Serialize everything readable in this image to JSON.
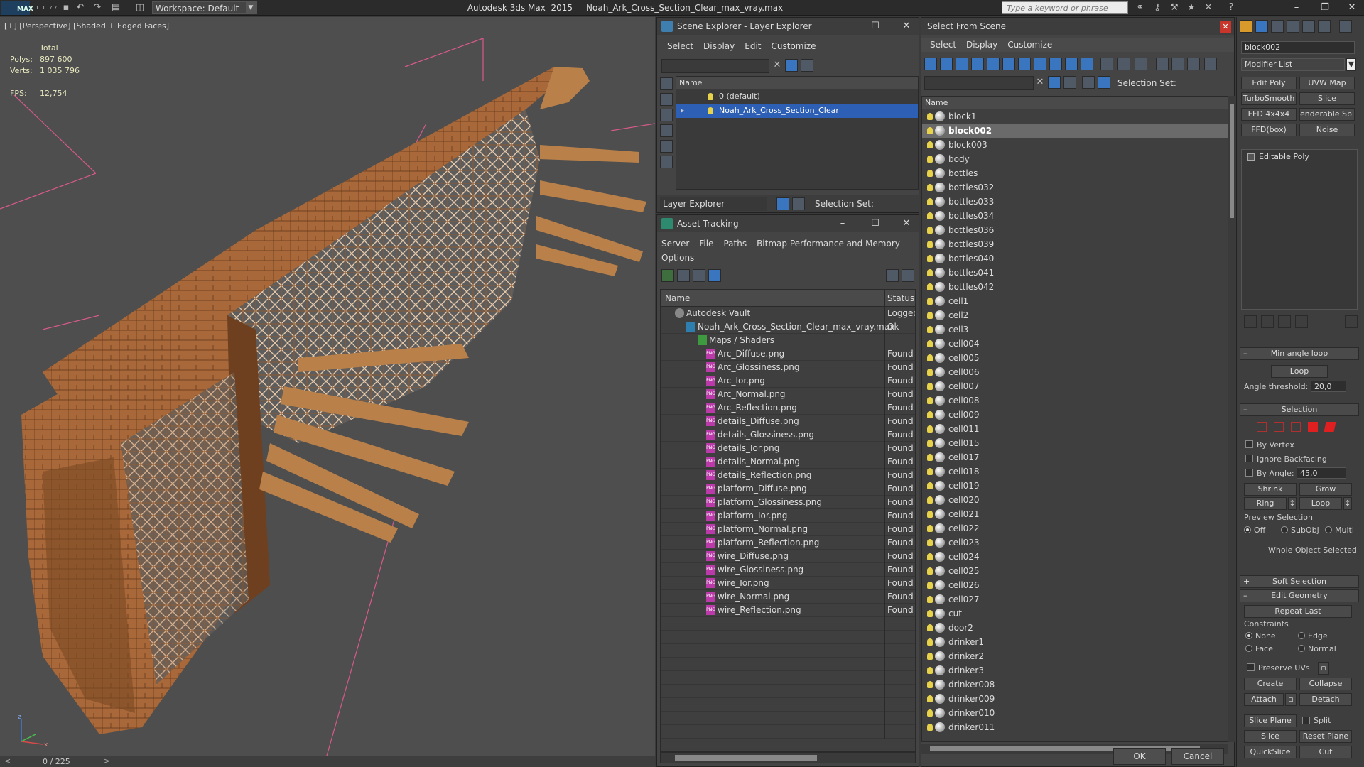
{
  "app": {
    "title": "Autodesk 3ds Max  2015     Noah_Ark_Cross_Section_Clear_max_vray.max",
    "logo": "MAX",
    "workspace": "Workspace: Default",
    "search_placeholder": "Type a keyword or phrase"
  },
  "viewport": {
    "label": "[+] [Perspective] [Shaded + Edged Faces]",
    "stats": {
      "total_label": "Total",
      "polys_label": "Polys:",
      "polys": "897 600",
      "verts_label": "Verts:",
      "verts": "1 035 796",
      "fps_label": "FPS:",
      "fps": "12,754"
    },
    "frame_counter": "0 / 225",
    "axis_x": "x",
    "axis_z": "z"
  },
  "scene_explorer": {
    "title": "Scene Explorer - Layer Explorer",
    "menu": [
      "Select",
      "Display",
      "Edit",
      "Customize"
    ],
    "column": "Name",
    "rows": [
      "0 (default)",
      "Noah_Ark_Cross_Section_Clear"
    ],
    "footer_dropdown": "Layer Explorer",
    "selection_set": "Selection Set:"
  },
  "asset_tracking": {
    "title": "Asset Tracking",
    "menu": [
      "Server",
      "File",
      "Paths",
      "Bitmap Performance and Memory"
    ],
    "menu2": [
      "Options"
    ],
    "columns": {
      "name": "Name",
      "status": "Status"
    },
    "rows": [
      {
        "name": "Autodesk Vault",
        "status": "Logged",
        "level": 0,
        "kind": "vault"
      },
      {
        "name": "Noah_Ark_Cross_Section_Clear_max_vray.max",
        "status": "Ok",
        "level": 1,
        "kind": "max"
      },
      {
        "name": "Maps / Shaders",
        "status": "",
        "level": 2,
        "kind": "folder"
      },
      {
        "name": "Arc_Diffuse.png",
        "status": "Found",
        "level": 3,
        "kind": "png"
      },
      {
        "name": "Arc_Glossiness.png",
        "status": "Found",
        "level": 3,
        "kind": "png"
      },
      {
        "name": "Arc_Ior.png",
        "status": "Found",
        "level": 3,
        "kind": "png"
      },
      {
        "name": "Arc_Normal.png",
        "status": "Found",
        "level": 3,
        "kind": "png"
      },
      {
        "name": "Arc_Reflection.png",
        "status": "Found",
        "level": 3,
        "kind": "png"
      },
      {
        "name": "details_Diffuse.png",
        "status": "Found",
        "level": 3,
        "kind": "png"
      },
      {
        "name": "details_Glossiness.png",
        "status": "Found",
        "level": 3,
        "kind": "png"
      },
      {
        "name": "details_Ior.png",
        "status": "Found",
        "level": 3,
        "kind": "png"
      },
      {
        "name": "details_Normal.png",
        "status": "Found",
        "level": 3,
        "kind": "png"
      },
      {
        "name": "details_Reflection.png",
        "status": "Found",
        "level": 3,
        "kind": "png"
      },
      {
        "name": "platform_Diffuse.png",
        "status": "Found",
        "level": 3,
        "kind": "png"
      },
      {
        "name": "platform_Glossiness.png",
        "status": "Found",
        "level": 3,
        "kind": "png"
      },
      {
        "name": "platform_Ior.png",
        "status": "Found",
        "level": 3,
        "kind": "png"
      },
      {
        "name": "platform_Normal.png",
        "status": "Found",
        "level": 3,
        "kind": "png"
      },
      {
        "name": "platform_Reflection.png",
        "status": "Found",
        "level": 3,
        "kind": "png"
      },
      {
        "name": "wire_Diffuse.png",
        "status": "Found",
        "level": 3,
        "kind": "png"
      },
      {
        "name": "wire_Glossiness.png",
        "status": "Found",
        "level": 3,
        "kind": "png"
      },
      {
        "name": "wire_Ior.png",
        "status": "Found",
        "level": 3,
        "kind": "png"
      },
      {
        "name": "wire_Normal.png",
        "status": "Found",
        "level": 3,
        "kind": "png"
      },
      {
        "name": "wire_Reflection.png",
        "status": "Found",
        "level": 3,
        "kind": "png"
      }
    ]
  },
  "select_from_scene": {
    "title": "Select From Scene",
    "menu": [
      "Select",
      "Display",
      "Customize"
    ],
    "selection_set": "Selection Set:",
    "column": "Name",
    "highlighted": "block002",
    "items": [
      "block1",
      "block002",
      "block003",
      "body",
      "bottles",
      "bottles032",
      "bottles033",
      "bottles034",
      "bottles036",
      "bottles039",
      "bottles040",
      "bottles041",
      "bottles042",
      "cell1",
      "cell2",
      "cell3",
      "cell004",
      "cell005",
      "cell006",
      "cell007",
      "cell008",
      "cell009",
      "cell011",
      "cell015",
      "cell017",
      "cell018",
      "cell019",
      "cell020",
      "cell021",
      "cell022",
      "cell023",
      "cell024",
      "cell025",
      "cell026",
      "cell027",
      "cut",
      "door2",
      "drinker1",
      "drinker2",
      "drinker3",
      "drinker008",
      "drinker009",
      "drinker010",
      "drinker011"
    ],
    "ok": "OK",
    "cancel": "Cancel"
  },
  "command_panel": {
    "object_name": "block002",
    "modifier_list": "Modifier List",
    "modifier_buttons": [
      "Edit Poly",
      "UVW Map",
      "TurboSmooth",
      "Slice",
      "FFD 4x4x4",
      "enderable Splin",
      "FFD(box)",
      "Noise"
    ],
    "stack_item": "Editable Poly",
    "min_angle_loop": "Min angle loop",
    "loop": "Loop",
    "angle_threshold_label": "Angle threshold:",
    "angle_threshold": "20,0",
    "selection_title": "Selection",
    "by_vertex": "By Vertex",
    "ignore_backfacing": "Ignore Backfacing",
    "by_angle": "By Angle:",
    "by_angle_value": "45,0",
    "shrink": "Shrink",
    "grow": "Grow",
    "ring": "Ring",
    "loop2": "Loop",
    "preview_selection": "Preview Selection",
    "preview_off": "Off",
    "preview_subobj": "SubObj",
    "preview_multi": "Multi",
    "whole_object": "Whole Object Selected",
    "soft_selection": "Soft Selection",
    "edit_geometry": "Edit Geometry",
    "repeat_last": "Repeat Last",
    "constraints": "Constraints",
    "c_none": "None",
    "c_edge": "Edge",
    "c_face": "Face",
    "c_normal": "Normal",
    "preserve_uvs": "Preserve UVs",
    "create": "Create",
    "collapse": "Collapse",
    "attach": "Attach",
    "detach": "Detach",
    "slice_plane": "Slice Plane",
    "split": "Split",
    "slice": "Slice",
    "reset_plane": "Reset Plane",
    "quickslice": "QuickSlice",
    "cut": "Cut"
  },
  "colors": {
    "viewport_bg": "#4e4e4e",
    "selection_blue": "#2d5fb4",
    "wood": "#a8683a",
    "png_icon": "#b93aa8",
    "close_red": "#c9352a"
  }
}
